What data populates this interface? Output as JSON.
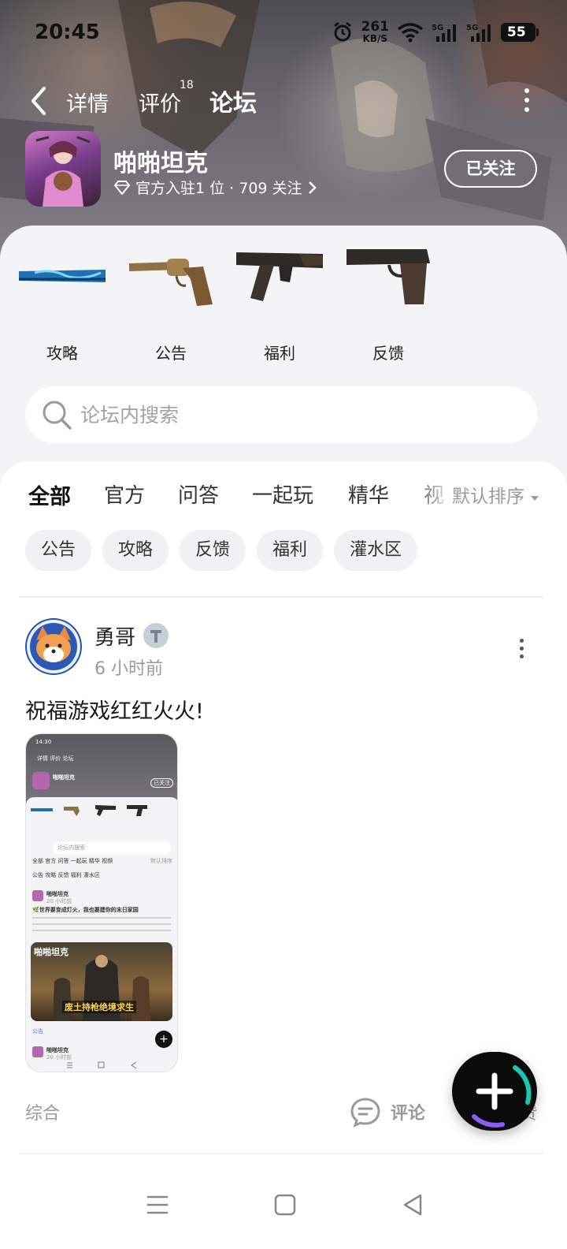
{
  "status_bar": {
    "time": "20:45",
    "net_speed_value": "261",
    "net_speed_unit": "KB/S",
    "battery": "55",
    "icons": [
      "alarm-icon",
      "wifi-icon",
      "signal-5g-icon",
      "signal-5g-icon",
      "battery-icon"
    ]
  },
  "nav": {
    "tabs": [
      {
        "label": "详情"
      },
      {
        "label": "评价",
        "badge": "18"
      },
      {
        "label": "论坛"
      }
    ],
    "active_tab": "论坛"
  },
  "game": {
    "name": "啪啪坦克",
    "meta": "官方入驻1 位 · 709 关注",
    "follow_label": "已关注"
  },
  "categories": [
    {
      "label": "攻略",
      "icon": "baseball-bat-icon"
    },
    {
      "label": "公告",
      "icon": "revolver-icon"
    },
    {
      "label": "福利",
      "icon": "assault-rifle-icon"
    },
    {
      "label": "反馈",
      "icon": "pistol-icon"
    }
  ],
  "search": {
    "placeholder": "论坛内搜索"
  },
  "feed_tabs": {
    "items": [
      "全部",
      "官方",
      "问答",
      "一起玩",
      "精华",
      "视"
    ],
    "active": "全部",
    "sort_label": "默认排序"
  },
  "chips": [
    "公告",
    "攻略",
    "反馈",
    "福利",
    "灌水区"
  ],
  "post": {
    "author": "勇哥",
    "time": "6 小时前",
    "title": "祝福游戏红红火火!",
    "footer_category": "综合",
    "comment_label": "评论",
    "like_label": "赞",
    "thumbnail": {
      "time": "14:30",
      "tabs": "详情   评价   论坛",
      "game_name": "啪啪坦克",
      "follow": "已关注",
      "search": "论坛内搜索",
      "feed_tabs": "全部  官方  问答  一起玩  精华  视频",
      "sort": "默认排序",
      "chips": "公告  攻略  反馈  福利  灌水区",
      "post_author": "啪啪坦克",
      "post_time": "20 小时前",
      "post_title": "🌿世界要变成灯火，我也要建你的末日家园",
      "banner_title": "啪啪坦克",
      "banner_caption": "废土持枪绝境求生",
      "footer": "公告",
      "next_author": "啪啪坦克",
      "next_time": "20 小时前"
    }
  },
  "fab": {
    "icon": "plus-icon"
  },
  "system_nav": {
    "icons": [
      "menu-icon",
      "home-icon",
      "back-icon"
    ]
  },
  "colors": {
    "accent": "#18c7b0",
    "muted": "#9a9a9a"
  }
}
